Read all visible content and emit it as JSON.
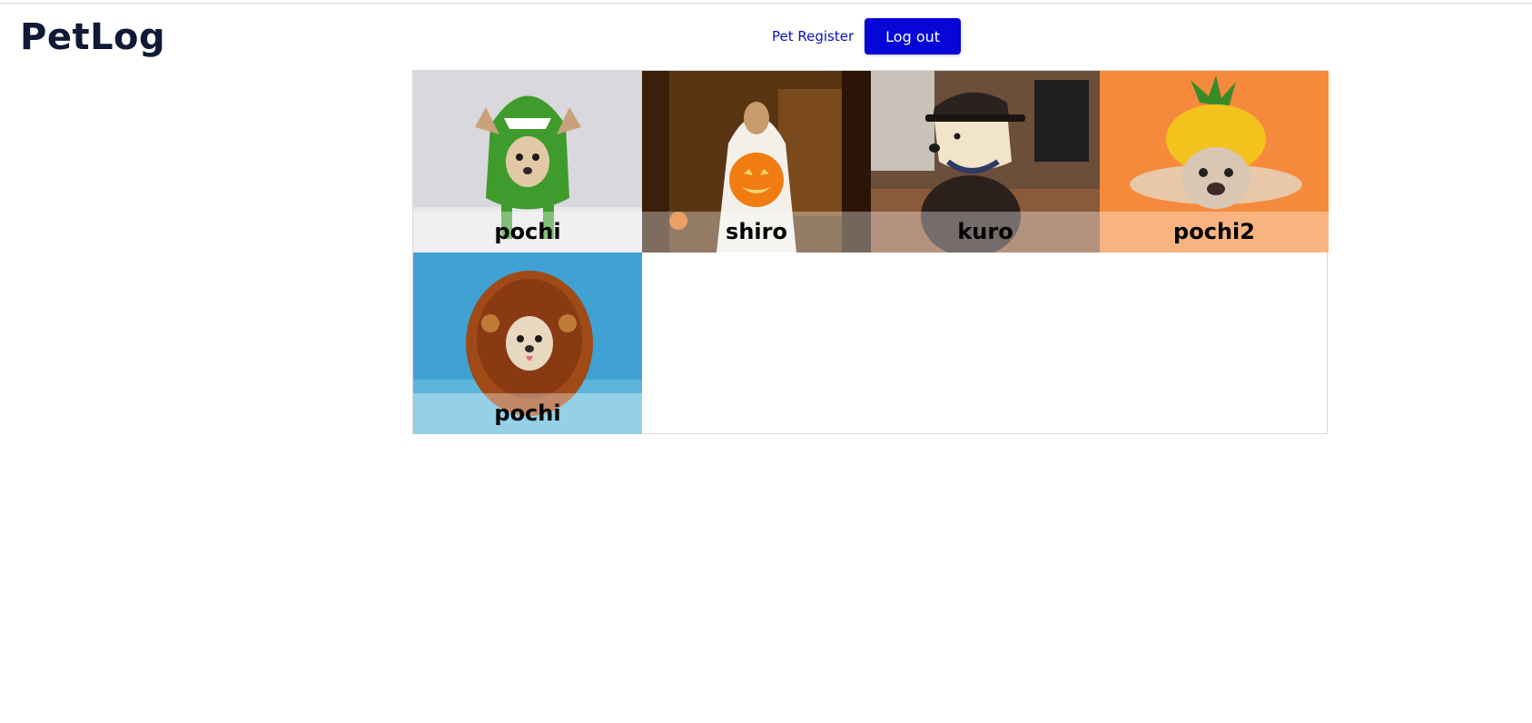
{
  "header": {
    "logo": "PetLog",
    "nav_register": "Pet Register",
    "logout": "Log out"
  },
  "colors": {
    "brand": "#101935",
    "link": "#0a10b8",
    "button": "#0606d6"
  },
  "pets": [
    {
      "name": "pochi",
      "icon": "dog-in-dinosaur-costume"
    },
    {
      "name": "shiro",
      "icon": "dog-ghost-with-pumpkin"
    },
    {
      "name": "kuro",
      "icon": "dog-in-delivery-uniform"
    },
    {
      "name": "pochi2",
      "icon": "bulldog-in-pineapple-costume"
    },
    {
      "name": "pochi",
      "icon": "dog-in-lion-mane"
    }
  ]
}
